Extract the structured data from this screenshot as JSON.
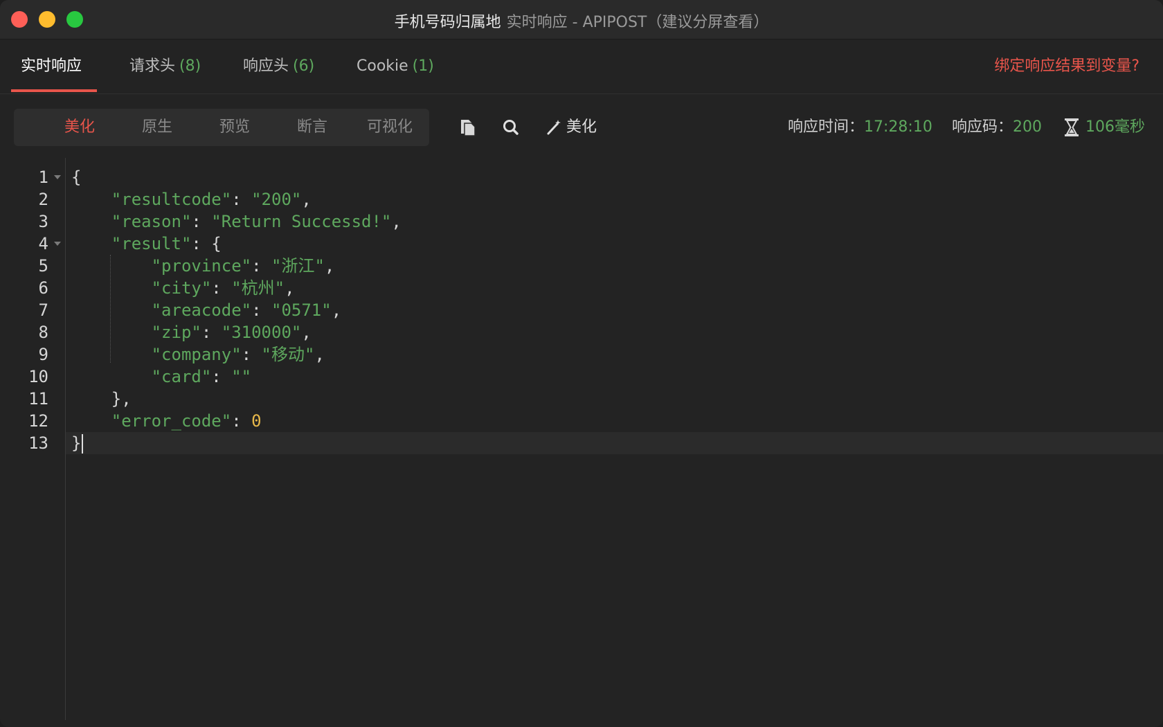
{
  "window": {
    "title_main": "手机号码归属地",
    "title_sub": "实时响应 - APIPOST（建议分屏查看）"
  },
  "tabs": [
    {
      "label": "实时响应",
      "count": ""
    },
    {
      "label": "请求头",
      "count": "(8)"
    },
    {
      "label": "响应头",
      "count": "(6)"
    },
    {
      "label": "Cookie",
      "count": "(1)"
    }
  ],
  "bind_link": "绑定响应结果到变量?",
  "view_modes": [
    "美化",
    "原生",
    "预览",
    "断言",
    "可视化"
  ],
  "toolbar": {
    "copy_icon": "copy-icon",
    "search_icon": "search-icon",
    "beautify_icon": "magic-wand-icon",
    "beautify_label": "美化"
  },
  "status": {
    "time_label": "响应时间：",
    "time_value": "17:28:10",
    "code_label": "响应码：",
    "code_value": "200",
    "duration_icon": "hourglass-icon",
    "duration_value": "106毫秒"
  },
  "colors": {
    "accent": "#e8554b",
    "green": "#5ea85e",
    "number": "#e7b84a"
  },
  "code_lines": [
    {
      "n": "1",
      "fold": true,
      "segments": [
        {
          "t": "{",
          "c": "punc"
        }
      ]
    },
    {
      "n": "2",
      "fold": false,
      "segments": [
        {
          "t": "    ",
          "c": "punc"
        },
        {
          "t": "\"resultcode\"",
          "c": "key"
        },
        {
          "t": ": ",
          "c": "punc"
        },
        {
          "t": "\"200\"",
          "c": "str"
        },
        {
          "t": ",",
          "c": "punc"
        }
      ]
    },
    {
      "n": "3",
      "fold": false,
      "segments": [
        {
          "t": "    ",
          "c": "punc"
        },
        {
          "t": "\"reason\"",
          "c": "key"
        },
        {
          "t": ": ",
          "c": "punc"
        },
        {
          "t": "\"Return Successd!\"",
          "c": "str"
        },
        {
          "t": ",",
          "c": "punc"
        }
      ]
    },
    {
      "n": "4",
      "fold": true,
      "segments": [
        {
          "t": "    ",
          "c": "punc"
        },
        {
          "t": "\"result\"",
          "c": "key"
        },
        {
          "t": ": {",
          "c": "punc"
        }
      ]
    },
    {
      "n": "5",
      "fold": false,
      "segments": [
        {
          "t": "        ",
          "c": "punc"
        },
        {
          "t": "\"province\"",
          "c": "key"
        },
        {
          "t": ": ",
          "c": "punc"
        },
        {
          "t": "\"浙江\"",
          "c": "str"
        },
        {
          "t": ",",
          "c": "punc"
        }
      ]
    },
    {
      "n": "6",
      "fold": false,
      "segments": [
        {
          "t": "        ",
          "c": "punc"
        },
        {
          "t": "\"city\"",
          "c": "key"
        },
        {
          "t": ": ",
          "c": "punc"
        },
        {
          "t": "\"杭州\"",
          "c": "str"
        },
        {
          "t": ",",
          "c": "punc"
        }
      ]
    },
    {
      "n": "7",
      "fold": false,
      "segments": [
        {
          "t": "        ",
          "c": "punc"
        },
        {
          "t": "\"areacode\"",
          "c": "key"
        },
        {
          "t": ": ",
          "c": "punc"
        },
        {
          "t": "\"0571\"",
          "c": "str"
        },
        {
          "t": ",",
          "c": "punc"
        }
      ]
    },
    {
      "n": "8",
      "fold": false,
      "segments": [
        {
          "t": "        ",
          "c": "punc"
        },
        {
          "t": "\"zip\"",
          "c": "key"
        },
        {
          "t": ": ",
          "c": "punc"
        },
        {
          "t": "\"310000\"",
          "c": "str"
        },
        {
          "t": ",",
          "c": "punc"
        }
      ]
    },
    {
      "n": "9",
      "fold": false,
      "segments": [
        {
          "t": "        ",
          "c": "punc"
        },
        {
          "t": "\"company\"",
          "c": "key"
        },
        {
          "t": ": ",
          "c": "punc"
        },
        {
          "t": "\"移动\"",
          "c": "str"
        },
        {
          "t": ",",
          "c": "punc"
        }
      ]
    },
    {
      "n": "10",
      "fold": false,
      "segments": [
        {
          "t": "        ",
          "c": "punc"
        },
        {
          "t": "\"card\"",
          "c": "key"
        },
        {
          "t": ": ",
          "c": "punc"
        },
        {
          "t": "\"\"",
          "c": "str"
        }
      ]
    },
    {
      "n": "11",
      "fold": false,
      "segments": [
        {
          "t": "    },",
          "c": "punc"
        }
      ]
    },
    {
      "n": "12",
      "fold": false,
      "segments": [
        {
          "t": "    ",
          "c": "punc"
        },
        {
          "t": "\"error_code\"",
          "c": "key"
        },
        {
          "t": ": ",
          "c": "punc"
        },
        {
          "t": "0",
          "c": "num"
        }
      ]
    },
    {
      "n": "13",
      "fold": false,
      "segments": [
        {
          "t": "}",
          "c": "punc"
        }
      ],
      "caret": true
    }
  ]
}
